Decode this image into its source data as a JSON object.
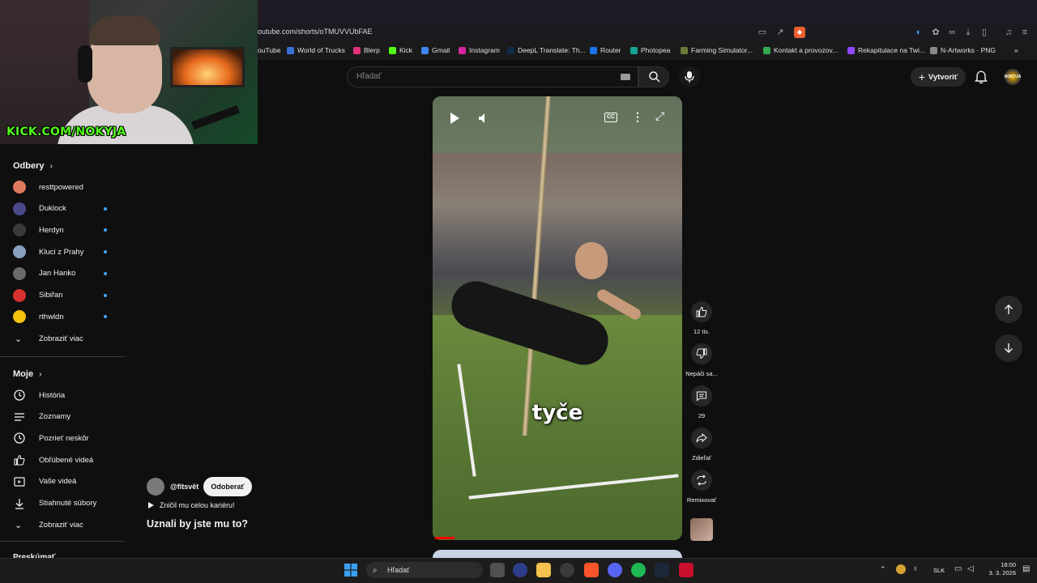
{
  "browser": {
    "url": "outube.com/shorts/oTMUVVUbFAE",
    "bookmarks": [
      "ouTube",
      "World of Trucks",
      "Blerp",
      "Kick",
      "Gmail",
      "Instagram",
      "DeepL Translate: Th...",
      "Router",
      "Photopea",
      "Farming Simulator...",
      "Kontakt a provozov...",
      "Rekapitulace na Twi...",
      "N-Artworks · PNG"
    ],
    "bookmark_colors": [
      "#ff0000",
      "#3b6fd8",
      "#e0307a",
      "#53fc18",
      "#4285f4",
      "#d6249f",
      "#0f2b46",
      "#1a73e8",
      "#18a497",
      "#6a7a3a",
      "#33a852",
      "#9146ff",
      "#888888"
    ]
  },
  "webcam": {
    "overlay_text": "KICK.COM/NOKYJA"
  },
  "header": {
    "search_placeholder": "Hľadať",
    "create_label": "Vytvoriť",
    "avatar_text": "NOKYJA"
  },
  "sidebar": {
    "subs_title": "Odbery",
    "subscriptions": [
      {
        "label": "resttpowered",
        "color": "#e07a5f",
        "new": false
      },
      {
        "label": "Duklock",
        "color": "#4a4a8a",
        "new": true
      },
      {
        "label": "Herdyn",
        "color": "#3a3a3a",
        "new": true
      },
      {
        "label": "Kluci z Prahy",
        "color": "#8aa0c0",
        "new": true
      },
      {
        "label": "Jan Hanko",
        "color": "#6a6a6a",
        "new": true
      },
      {
        "label": "Sibiřan",
        "color": "#d8312f",
        "new": true
      },
      {
        "label": "rthwldn",
        "color": "#f4c20d",
        "new": true
      }
    ],
    "subs_more": "Zobraziť viac",
    "you_title": "Moje",
    "you_items": [
      {
        "label": "História",
        "icon": "history-icon"
      },
      {
        "label": "Zoznamy",
        "icon": "playlists-icon"
      },
      {
        "label": "Pozrieť neskôr",
        "icon": "watch-later-icon"
      },
      {
        "label": "Obľúbené videá",
        "icon": "liked-icon"
      },
      {
        "label": "Vaše videá",
        "icon": "your-videos-icon"
      },
      {
        "label": "Stiahnuté súbory",
        "icon": "download-icon"
      }
    ],
    "you_more": "Zobraziť viac",
    "cut_section": "Preskúmať"
  },
  "short": {
    "caption": "tyče",
    "progress_fraction": 0.08,
    "channel": "@fitsvět",
    "subscribe_label": "Odoberať",
    "sound_label": "Zničil mu celou kariéru!",
    "title": "Uznali by jste mu to?"
  },
  "actions": {
    "like_count": "12 tis.",
    "dislike_label": "Nepáči sa...",
    "comment_count": "29",
    "share_label": "Zdieľať",
    "remix_label": "Remixovať"
  },
  "taskbar": {
    "search_label": "Hľadať",
    "lang": "SLK",
    "time": "18:00",
    "date": "3. 3. 2026"
  }
}
